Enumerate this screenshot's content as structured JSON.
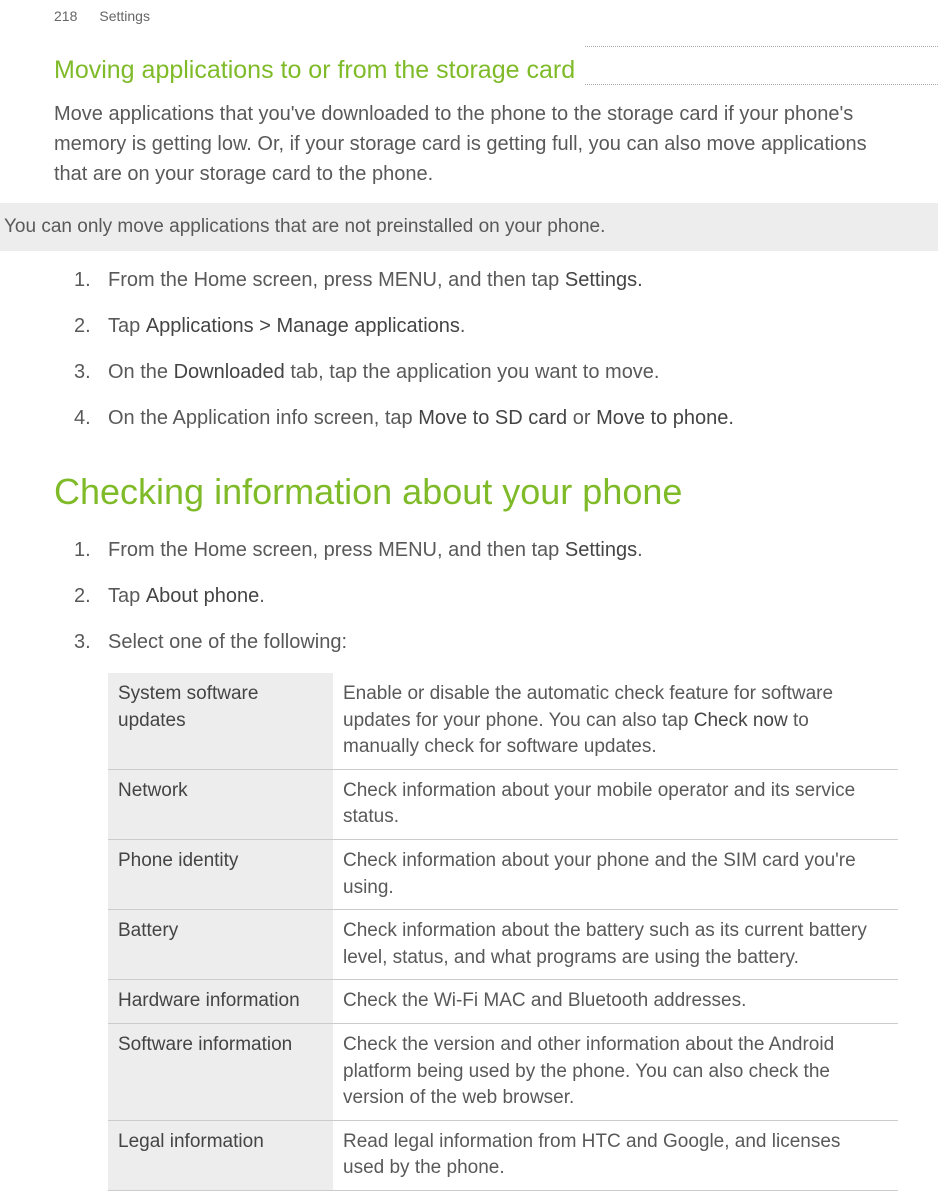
{
  "header": {
    "page_number": "218",
    "breadcrumb": "Settings"
  },
  "section1": {
    "heading": "Moving applications to or from the storage card",
    "intro": "Move applications that you've downloaded to the phone to the storage card if your phone's memory is getting low. Or, if your storage card is getting full, you can also move applications that are on your storage card to the phone.",
    "callout": "You can only move applications that are not preinstalled on your phone.",
    "steps": [
      {
        "num": "1.",
        "pre": "From the Home screen, press MENU, and then tap ",
        "strong": "Settings.",
        "post": ""
      },
      {
        "num": "2.",
        "pre": "Tap ",
        "strong": "Applications > Manage applications",
        "post": "."
      },
      {
        "num": "3.",
        "pre": "On the ",
        "strong": "Downloaded",
        "post": " tab, tap the application you want to move."
      },
      {
        "num": "4.",
        "pre": "On the Application info screen, tap ",
        "strong": "Move to SD card",
        "post_mid": " or ",
        "strong2": "Move to phone.",
        "post": ""
      }
    ]
  },
  "section2": {
    "heading": "Checking information about your phone",
    "steps": [
      {
        "num": "1.",
        "pre": "From the Home screen, press MENU, and then tap ",
        "strong": "Settings",
        "post": "."
      },
      {
        "num": "2.",
        "pre": "Tap ",
        "strong": "About phone",
        "post": "."
      },
      {
        "num": "3.",
        "pre": "Select one of the following:",
        "strong": "",
        "post": ""
      }
    ],
    "table": [
      {
        "label": "System software updates",
        "desc_pre": "Enable or disable the automatic check feature for software updates for your phone. You can also tap ",
        "desc_strong": "Check now",
        "desc_post": " to manually check for software updates."
      },
      {
        "label": "Network",
        "desc_pre": "Check information about your mobile operator and its service status.",
        "desc_strong": "",
        "desc_post": ""
      },
      {
        "label": "Phone identity",
        "desc_pre": "Check information about your phone and the SIM card you're using.",
        "desc_strong": "",
        "desc_post": ""
      },
      {
        "label": "Battery",
        "desc_pre": "Check information about the battery such as its current battery level, status, and what programs are using the battery.",
        "desc_strong": "",
        "desc_post": ""
      },
      {
        "label": "Hardware information",
        "desc_pre": "Check the Wi-Fi MAC and Bluetooth addresses.",
        "desc_strong": "",
        "desc_post": ""
      },
      {
        "label": "Software information",
        "desc_pre": "Check the version and other information about the Android platform being used by the phone. You can also check the version of the web browser.",
        "desc_strong": "",
        "desc_post": ""
      },
      {
        "label": "Legal information",
        "desc_pre": "Read legal information from HTC and Google, and licenses used by the phone.",
        "desc_strong": "",
        "desc_post": ""
      }
    ]
  }
}
